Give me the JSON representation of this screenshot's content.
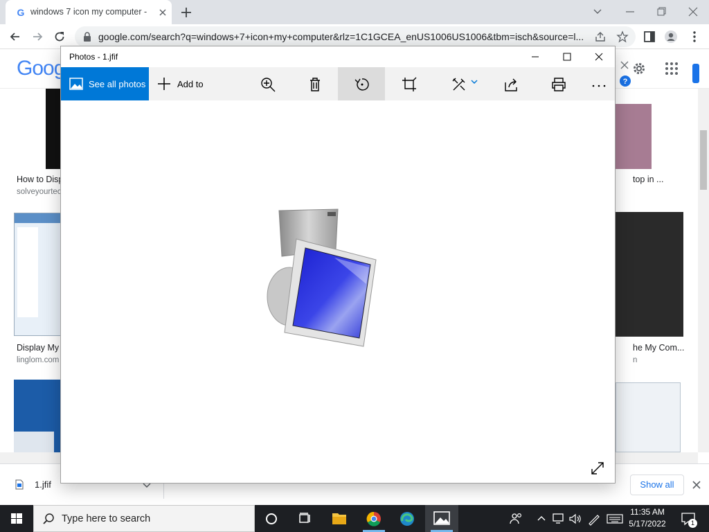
{
  "browser": {
    "tab": {
      "title": "windows 7 icon my computer - G",
      "favicon": "G"
    },
    "url": "google.com/search?q=windows+7+icon+my+computer&rlz=1C1GCEA_enUS1006US1006&tbm=isch&source=l..."
  },
  "google": {
    "logo_text": "Goog",
    "results": [
      {
        "caption": "How to Disp",
        "source": "solveyourtec"
      },
      {
        "caption": "Display My",
        "source": "linglom.com"
      },
      {
        "caption": "top in ...",
        "source": ""
      },
      {
        "caption": "he My Com...",
        "source": "n"
      }
    ]
  },
  "download_bar": {
    "file_name": "1.jfif",
    "show_all_label": "Show all"
  },
  "photos": {
    "window_title": "Photos - 1.jfif",
    "see_all_label": "See all photos",
    "add_to_label": "Add to",
    "tools": [
      "zoom-in-icon",
      "delete-icon",
      "rotate-icon",
      "crop-icon",
      "edit-icon",
      "share-icon",
      "print-icon",
      "more-icon"
    ],
    "accent_color": "#0078d7"
  },
  "taskbar": {
    "search_placeholder": "Type here to search",
    "time": "11:35 AM",
    "date": "5/17/2022",
    "notification_count": "1"
  }
}
